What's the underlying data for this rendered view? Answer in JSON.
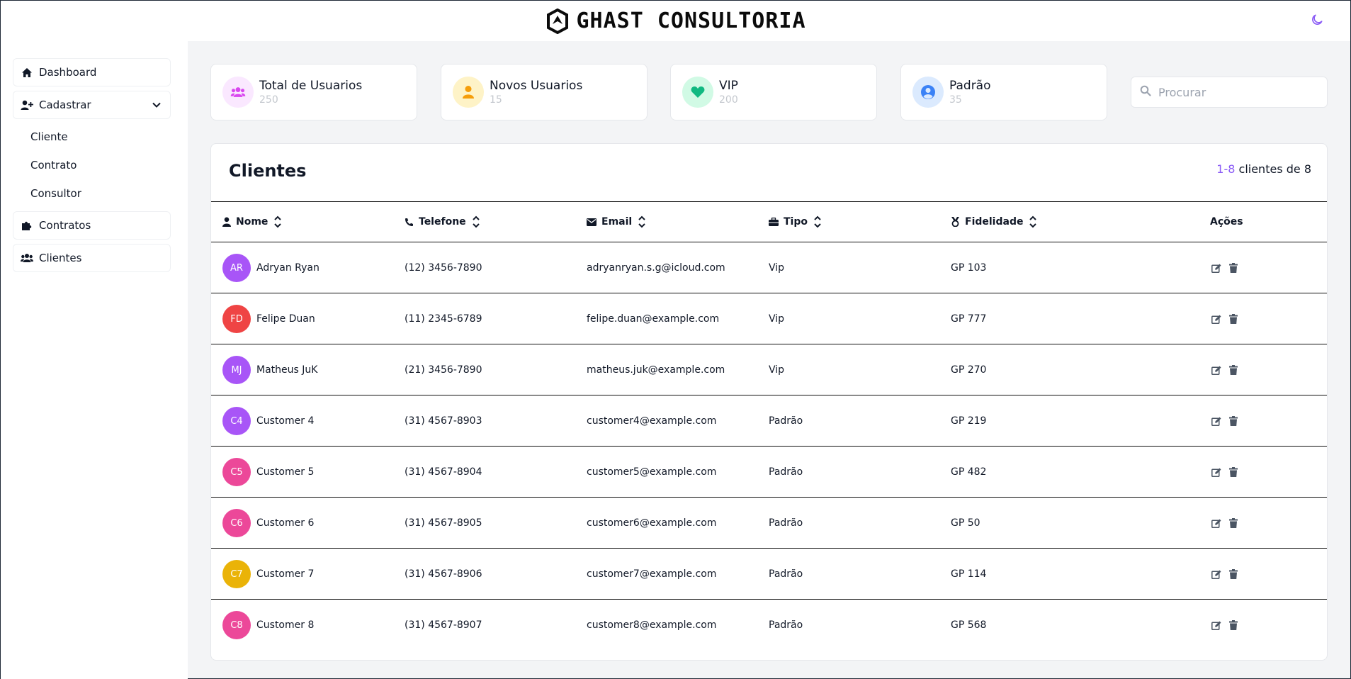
{
  "header": {
    "brand": "GHAST CONSULTORIA",
    "theme_icon": "moon-icon",
    "accent": "#8b5cf6"
  },
  "sidebar": {
    "items": [
      {
        "label": "Dashboard",
        "icon": "home-icon"
      },
      {
        "label": "Cadastrar",
        "icon": "user-plus-icon"
      },
      {
        "label": "Contratos",
        "icon": "puzzle-icon"
      },
      {
        "label": "Clientes",
        "icon": "users-icon"
      }
    ],
    "sub_items": [
      {
        "label": "Cliente"
      },
      {
        "label": "Contrato"
      },
      {
        "label": "Consultor"
      }
    ]
  },
  "stats": [
    {
      "title": "Total de Usuarios",
      "value": "250",
      "icon": "users-icon",
      "color": "#d946ef",
      "bg": "#fae8ff"
    },
    {
      "title": "Novos Usuarios",
      "value": "15",
      "icon": "user-icon",
      "color": "#f59e0b",
      "bg": "#fef3c7"
    },
    {
      "title": "VIP",
      "value": "200",
      "icon": "heart-icon",
      "color": "#10b981",
      "bg": "#d1fae5"
    },
    {
      "title": "Padrão",
      "value": "35",
      "icon": "user-circle-icon",
      "color": "#3b82f6",
      "bg": "#dbeafe"
    }
  ],
  "search": {
    "placeholder": "Procurar"
  },
  "table": {
    "title": "Clientes",
    "pager_range": "1-8",
    "pager_text": " clientes de 8",
    "columns": {
      "nome": "Nome",
      "telefone": "Telefone",
      "email": "Email",
      "tipo": "Tipo",
      "fidelidade": "Fidelidade",
      "acoes": "Ações"
    },
    "rows": [
      {
        "initials": "AR",
        "color": "#a855f7",
        "nome": "Adryan Ryan",
        "telefone": "(12) 3456-7890",
        "email": "adryanryan.s.g@icloud.com",
        "tipo": "Vip",
        "fidelidade": "GP 103"
      },
      {
        "initials": "FD",
        "color": "#ef4444",
        "nome": "Felipe Duan",
        "telefone": "(11) 2345-6789",
        "email": "felipe.duan@example.com",
        "tipo": "Vip",
        "fidelidade": "GP 777"
      },
      {
        "initials": "MJ",
        "color": "#a855f7",
        "nome": "Matheus JuK",
        "telefone": "(21) 3456-7890",
        "email": "matheus.juk@example.com",
        "tipo": "Vip",
        "fidelidade": "GP 270"
      },
      {
        "initials": "C4",
        "color": "#a855f7",
        "nome": "Customer 4",
        "telefone": "(31) 4567-8903",
        "email": "customer4@example.com",
        "tipo": "Padrão",
        "fidelidade": "GP 219"
      },
      {
        "initials": "C5",
        "color": "#ec4899",
        "nome": "Customer 5",
        "telefone": "(31) 4567-8904",
        "email": "customer5@example.com",
        "tipo": "Padrão",
        "fidelidade": "GP 482"
      },
      {
        "initials": "C6",
        "color": "#ec4899",
        "nome": "Customer 6",
        "telefone": "(31) 4567-8905",
        "email": "customer6@example.com",
        "tipo": "Padrão",
        "fidelidade": "GP 50"
      },
      {
        "initials": "C7",
        "color": "#eab308",
        "nome": "Customer 7",
        "telefone": "(31) 4567-8906",
        "email": "customer7@example.com",
        "tipo": "Padrão",
        "fidelidade": "GP 114"
      },
      {
        "initials": "C8",
        "color": "#ec4899",
        "nome": "Customer 8",
        "telefone": "(31) 4567-8907",
        "email": "customer8@example.com",
        "tipo": "Padrão",
        "fidelidade": "GP 568"
      }
    ]
  }
}
